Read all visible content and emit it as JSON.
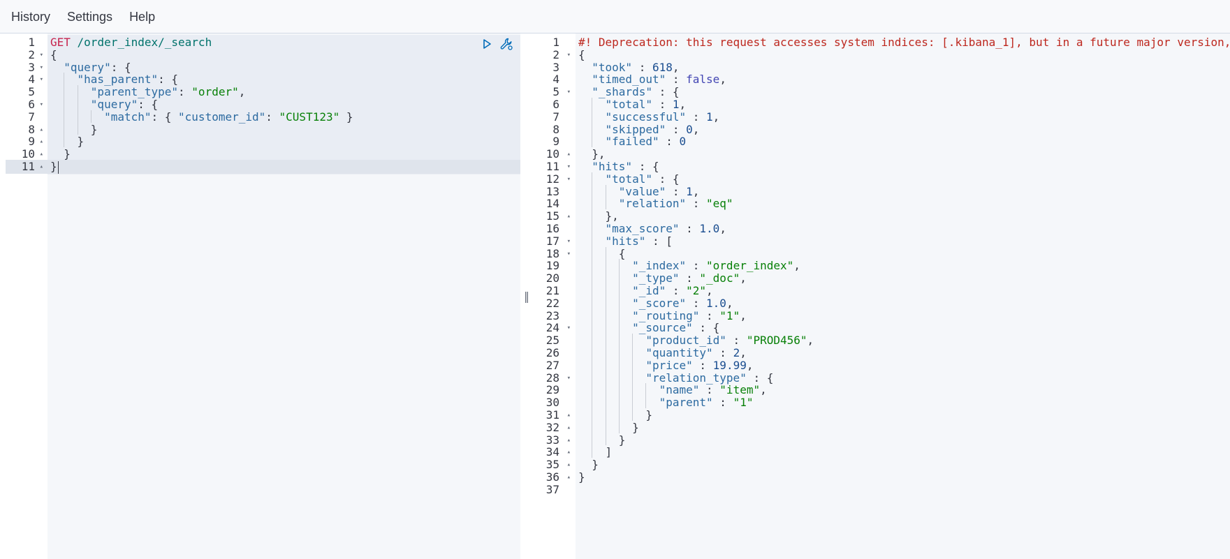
{
  "menu": {
    "items": [
      "History",
      "Settings",
      "Help"
    ]
  },
  "colors": {
    "method": "#c7254e",
    "url": "#00726b",
    "key": "#2c6aa0",
    "string": "#088008",
    "number": "#1a4d8f",
    "boolean": "#4346b3",
    "warning": "#bd271e"
  },
  "icons": {
    "run": "play-icon",
    "settings": "wrench-icon",
    "resizer": "double-bar-icon"
  },
  "request": {
    "active_line": 11,
    "lines": [
      {
        "n": 1,
        "fold": "",
        "tokens": [
          {
            "t": "GET",
            "c": "method"
          },
          {
            "t": " /order_index/_search",
            "c": "url"
          }
        ]
      },
      {
        "n": 2,
        "fold": "down",
        "tokens": [
          {
            "t": "{",
            "c": "punc"
          }
        ]
      },
      {
        "n": 3,
        "fold": "down",
        "tokens": [
          {
            "t": "  ",
            "c": "punc"
          },
          {
            "t": "\"query\"",
            "c": "key"
          },
          {
            "t": ": {",
            "c": "punc"
          }
        ]
      },
      {
        "n": 4,
        "fold": "down",
        "tokens": [
          {
            "t": "    ",
            "c": "punc"
          },
          {
            "t": "\"has_parent\"",
            "c": "key"
          },
          {
            "t": ": {",
            "c": "punc"
          }
        ]
      },
      {
        "n": 5,
        "fold": "",
        "tokens": [
          {
            "t": "      ",
            "c": "punc"
          },
          {
            "t": "\"parent_type\"",
            "c": "key"
          },
          {
            "t": ": ",
            "c": "punc"
          },
          {
            "t": "\"order\"",
            "c": "str"
          },
          {
            "t": ",",
            "c": "punc"
          }
        ]
      },
      {
        "n": 6,
        "fold": "down",
        "tokens": [
          {
            "t": "      ",
            "c": "punc"
          },
          {
            "t": "\"query\"",
            "c": "key"
          },
          {
            "t": ": {",
            "c": "punc"
          }
        ]
      },
      {
        "n": 7,
        "fold": "",
        "tokens": [
          {
            "t": "        ",
            "c": "punc"
          },
          {
            "t": "\"match\"",
            "c": "key"
          },
          {
            "t": ": { ",
            "c": "punc"
          },
          {
            "t": "\"customer_id\"",
            "c": "key"
          },
          {
            "t": ": ",
            "c": "punc"
          },
          {
            "t": "\"CUST123\"",
            "c": "str"
          },
          {
            "t": " }",
            "c": "punc"
          }
        ]
      },
      {
        "n": 8,
        "fold": "up",
        "tokens": [
          {
            "t": "      }",
            "c": "punc"
          }
        ]
      },
      {
        "n": 9,
        "fold": "up",
        "tokens": [
          {
            "t": "    }",
            "c": "punc"
          }
        ]
      },
      {
        "n": 10,
        "fold": "up",
        "tokens": [
          {
            "t": "  }",
            "c": "punc"
          }
        ]
      },
      {
        "n": 11,
        "fold": "up",
        "tokens": [
          {
            "t": "}",
            "c": "punc"
          }
        ]
      }
    ]
  },
  "response": {
    "lines": [
      {
        "n": 1,
        "fold": "",
        "tokens": [
          {
            "t": "#! Deprecation: this request accesses system indices: [.kibana_1], but in a future major version,",
            "c": "warn"
          }
        ]
      },
      {
        "n": 2,
        "fold": "down",
        "tokens": [
          {
            "t": "{",
            "c": "punc"
          }
        ]
      },
      {
        "n": 3,
        "fold": "",
        "tokens": [
          {
            "t": "  ",
            "c": "punc"
          },
          {
            "t": "\"took\"",
            "c": "key"
          },
          {
            "t": " : ",
            "c": "punc"
          },
          {
            "t": "618",
            "c": "num"
          },
          {
            "t": ",",
            "c": "punc"
          }
        ]
      },
      {
        "n": 4,
        "fold": "",
        "tokens": [
          {
            "t": "  ",
            "c": "punc"
          },
          {
            "t": "\"timed_out\"",
            "c": "key"
          },
          {
            "t": " : ",
            "c": "punc"
          },
          {
            "t": "false",
            "c": "bool"
          },
          {
            "t": ",",
            "c": "punc"
          }
        ]
      },
      {
        "n": 5,
        "fold": "down",
        "tokens": [
          {
            "t": "  ",
            "c": "punc"
          },
          {
            "t": "\"_shards\"",
            "c": "key"
          },
          {
            "t": " : {",
            "c": "punc"
          }
        ]
      },
      {
        "n": 6,
        "fold": "",
        "tokens": [
          {
            "t": "    ",
            "c": "punc"
          },
          {
            "t": "\"total\"",
            "c": "key"
          },
          {
            "t": " : ",
            "c": "punc"
          },
          {
            "t": "1",
            "c": "num"
          },
          {
            "t": ",",
            "c": "punc"
          }
        ]
      },
      {
        "n": 7,
        "fold": "",
        "tokens": [
          {
            "t": "    ",
            "c": "punc"
          },
          {
            "t": "\"successful\"",
            "c": "key"
          },
          {
            "t": " : ",
            "c": "punc"
          },
          {
            "t": "1",
            "c": "num"
          },
          {
            "t": ",",
            "c": "punc"
          }
        ]
      },
      {
        "n": 8,
        "fold": "",
        "tokens": [
          {
            "t": "    ",
            "c": "punc"
          },
          {
            "t": "\"skipped\"",
            "c": "key"
          },
          {
            "t": " : ",
            "c": "punc"
          },
          {
            "t": "0",
            "c": "num"
          },
          {
            "t": ",",
            "c": "punc"
          }
        ]
      },
      {
        "n": 9,
        "fold": "",
        "tokens": [
          {
            "t": "    ",
            "c": "punc"
          },
          {
            "t": "\"failed\"",
            "c": "key"
          },
          {
            "t": " : ",
            "c": "punc"
          },
          {
            "t": "0",
            "c": "num"
          }
        ]
      },
      {
        "n": 10,
        "fold": "up",
        "tokens": [
          {
            "t": "  },",
            "c": "punc"
          }
        ]
      },
      {
        "n": 11,
        "fold": "down",
        "tokens": [
          {
            "t": "  ",
            "c": "punc"
          },
          {
            "t": "\"hits\"",
            "c": "key"
          },
          {
            "t": " : {",
            "c": "punc"
          }
        ]
      },
      {
        "n": 12,
        "fold": "down",
        "tokens": [
          {
            "t": "    ",
            "c": "punc"
          },
          {
            "t": "\"total\"",
            "c": "key"
          },
          {
            "t": " : {",
            "c": "punc"
          }
        ]
      },
      {
        "n": 13,
        "fold": "",
        "tokens": [
          {
            "t": "      ",
            "c": "punc"
          },
          {
            "t": "\"value\"",
            "c": "key"
          },
          {
            "t": " : ",
            "c": "punc"
          },
          {
            "t": "1",
            "c": "num"
          },
          {
            "t": ",",
            "c": "punc"
          }
        ]
      },
      {
        "n": 14,
        "fold": "",
        "tokens": [
          {
            "t": "      ",
            "c": "punc"
          },
          {
            "t": "\"relation\"",
            "c": "key"
          },
          {
            "t": " : ",
            "c": "punc"
          },
          {
            "t": "\"eq\"",
            "c": "str"
          }
        ]
      },
      {
        "n": 15,
        "fold": "up",
        "tokens": [
          {
            "t": "    },",
            "c": "punc"
          }
        ]
      },
      {
        "n": 16,
        "fold": "",
        "tokens": [
          {
            "t": "    ",
            "c": "punc"
          },
          {
            "t": "\"max_score\"",
            "c": "key"
          },
          {
            "t": " : ",
            "c": "punc"
          },
          {
            "t": "1.0",
            "c": "num"
          },
          {
            "t": ",",
            "c": "punc"
          }
        ]
      },
      {
        "n": 17,
        "fold": "down",
        "tokens": [
          {
            "t": "    ",
            "c": "punc"
          },
          {
            "t": "\"hits\"",
            "c": "key"
          },
          {
            "t": " : [",
            "c": "punc"
          }
        ]
      },
      {
        "n": 18,
        "fold": "down",
        "tokens": [
          {
            "t": "      {",
            "c": "punc"
          }
        ]
      },
      {
        "n": 19,
        "fold": "",
        "tokens": [
          {
            "t": "        ",
            "c": "punc"
          },
          {
            "t": "\"_index\"",
            "c": "key"
          },
          {
            "t": " : ",
            "c": "punc"
          },
          {
            "t": "\"order_index\"",
            "c": "str"
          },
          {
            "t": ",",
            "c": "punc"
          }
        ]
      },
      {
        "n": 20,
        "fold": "",
        "tokens": [
          {
            "t": "        ",
            "c": "punc"
          },
          {
            "t": "\"_type\"",
            "c": "key"
          },
          {
            "t": " : ",
            "c": "punc"
          },
          {
            "t": "\"_doc\"",
            "c": "str"
          },
          {
            "t": ",",
            "c": "punc"
          }
        ]
      },
      {
        "n": 21,
        "fold": "",
        "tokens": [
          {
            "t": "        ",
            "c": "punc"
          },
          {
            "t": "\"_id\"",
            "c": "key"
          },
          {
            "t": " : ",
            "c": "punc"
          },
          {
            "t": "\"2\"",
            "c": "str"
          },
          {
            "t": ",",
            "c": "punc"
          }
        ]
      },
      {
        "n": 22,
        "fold": "",
        "tokens": [
          {
            "t": "        ",
            "c": "punc"
          },
          {
            "t": "\"_score\"",
            "c": "key"
          },
          {
            "t": " : ",
            "c": "punc"
          },
          {
            "t": "1.0",
            "c": "num"
          },
          {
            "t": ",",
            "c": "punc"
          }
        ]
      },
      {
        "n": 23,
        "fold": "",
        "tokens": [
          {
            "t": "        ",
            "c": "punc"
          },
          {
            "t": "\"_routing\"",
            "c": "key"
          },
          {
            "t": " : ",
            "c": "punc"
          },
          {
            "t": "\"1\"",
            "c": "str"
          },
          {
            "t": ",",
            "c": "punc"
          }
        ]
      },
      {
        "n": 24,
        "fold": "down",
        "tokens": [
          {
            "t": "        ",
            "c": "punc"
          },
          {
            "t": "\"_source\"",
            "c": "key"
          },
          {
            "t": " : {",
            "c": "punc"
          }
        ]
      },
      {
        "n": 25,
        "fold": "",
        "tokens": [
          {
            "t": "          ",
            "c": "punc"
          },
          {
            "t": "\"product_id\"",
            "c": "key"
          },
          {
            "t": " : ",
            "c": "punc"
          },
          {
            "t": "\"PROD456\"",
            "c": "str"
          },
          {
            "t": ",",
            "c": "punc"
          }
        ]
      },
      {
        "n": 26,
        "fold": "",
        "tokens": [
          {
            "t": "          ",
            "c": "punc"
          },
          {
            "t": "\"quantity\"",
            "c": "key"
          },
          {
            "t": " : ",
            "c": "punc"
          },
          {
            "t": "2",
            "c": "num"
          },
          {
            "t": ",",
            "c": "punc"
          }
        ]
      },
      {
        "n": 27,
        "fold": "",
        "tokens": [
          {
            "t": "          ",
            "c": "punc"
          },
          {
            "t": "\"price\"",
            "c": "key"
          },
          {
            "t": " : ",
            "c": "punc"
          },
          {
            "t": "19.99",
            "c": "num"
          },
          {
            "t": ",",
            "c": "punc"
          }
        ]
      },
      {
        "n": 28,
        "fold": "down",
        "tokens": [
          {
            "t": "          ",
            "c": "punc"
          },
          {
            "t": "\"relation_type\"",
            "c": "key"
          },
          {
            "t": " : {",
            "c": "punc"
          }
        ]
      },
      {
        "n": 29,
        "fold": "",
        "tokens": [
          {
            "t": "            ",
            "c": "punc"
          },
          {
            "t": "\"name\"",
            "c": "key"
          },
          {
            "t": " : ",
            "c": "punc"
          },
          {
            "t": "\"item\"",
            "c": "str"
          },
          {
            "t": ",",
            "c": "punc"
          }
        ]
      },
      {
        "n": 30,
        "fold": "",
        "tokens": [
          {
            "t": "            ",
            "c": "punc"
          },
          {
            "t": "\"parent\"",
            "c": "key"
          },
          {
            "t": " : ",
            "c": "punc"
          },
          {
            "t": "\"1\"",
            "c": "str"
          }
        ]
      },
      {
        "n": 31,
        "fold": "up",
        "tokens": [
          {
            "t": "          }",
            "c": "punc"
          }
        ]
      },
      {
        "n": 32,
        "fold": "up",
        "tokens": [
          {
            "t": "        }",
            "c": "punc"
          }
        ]
      },
      {
        "n": 33,
        "fold": "up",
        "tokens": [
          {
            "t": "      }",
            "c": "punc"
          }
        ]
      },
      {
        "n": 34,
        "fold": "up",
        "tokens": [
          {
            "t": "    ]",
            "c": "punc"
          }
        ]
      },
      {
        "n": 35,
        "fold": "up",
        "tokens": [
          {
            "t": "  }",
            "c": "punc"
          }
        ]
      },
      {
        "n": 36,
        "fold": "up",
        "tokens": [
          {
            "t": "}",
            "c": "punc"
          }
        ]
      },
      {
        "n": 37,
        "fold": "",
        "tokens": []
      }
    ]
  }
}
